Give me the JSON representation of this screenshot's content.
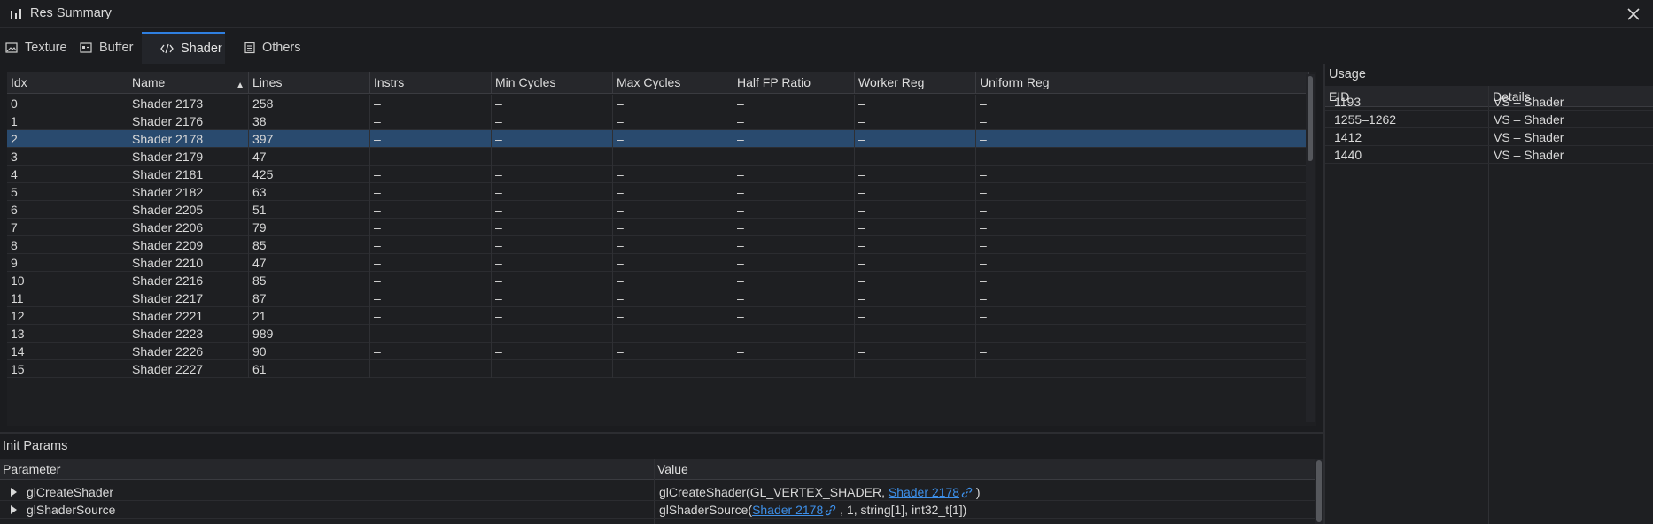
{
  "window": {
    "title": "Res Summary"
  },
  "tabs": [
    {
      "label": "Texture",
      "icon": "image-icon"
    },
    {
      "label": "Buffer",
      "icon": "buffer-icon"
    },
    {
      "label": "Shader",
      "icon": "code-icon",
      "active": true
    },
    {
      "label": "Others",
      "icon": "list-icon"
    }
  ],
  "shader_table": {
    "columns": [
      "Idx",
      "Name",
      "Lines",
      "Instrs",
      "Min Cycles",
      "Max Cycles",
      "Half FP Ratio",
      "Worker Reg",
      "Uniform Reg"
    ],
    "sorted_column": "Name",
    "selected_row": 2,
    "rows": [
      [
        "0",
        "Shader 2173",
        "258",
        "–",
        "–",
        "–",
        "–",
        "–",
        "–"
      ],
      [
        "1",
        "Shader 2176",
        "38",
        "–",
        "–",
        "–",
        "–",
        "–",
        "–"
      ],
      [
        "2",
        "Shader 2178",
        "397",
        "–",
        "–",
        "–",
        "–",
        "–",
        "–"
      ],
      [
        "3",
        "Shader 2179",
        "47",
        "–",
        "–",
        "–",
        "–",
        "–",
        "–"
      ],
      [
        "4",
        "Shader 2181",
        "425",
        "–",
        "–",
        "–",
        "–",
        "–",
        "–"
      ],
      [
        "5",
        "Shader 2182",
        "63",
        "–",
        "–",
        "–",
        "–",
        "–",
        "–"
      ],
      [
        "6",
        "Shader 2205",
        "51",
        "–",
        "–",
        "–",
        "–",
        "–",
        "–"
      ],
      [
        "7",
        "Shader 2206",
        "79",
        "–",
        "–",
        "–",
        "–",
        "–",
        "–"
      ],
      [
        "8",
        "Shader 2209",
        "85",
        "–",
        "–",
        "–",
        "–",
        "–",
        "–"
      ],
      [
        "9",
        "Shader 2210",
        "47",
        "–",
        "–",
        "–",
        "–",
        "–",
        "–"
      ],
      [
        "10",
        "Shader 2216",
        "85",
        "–",
        "–",
        "–",
        "–",
        "–",
        "–"
      ],
      [
        "11",
        "Shader 2217",
        "87",
        "–",
        "–",
        "–",
        "–",
        "–",
        "–"
      ],
      [
        "12",
        "Shader 2221",
        "21",
        "–",
        "–",
        "–",
        "–",
        "–",
        "–"
      ],
      [
        "13",
        "Shader 2223",
        "989",
        "–",
        "–",
        "–",
        "–",
        "–",
        "–"
      ],
      [
        "14",
        "Shader 2226",
        "90",
        "–",
        "–",
        "–",
        "–",
        "–",
        "–"
      ],
      [
        "15",
        "Shader 2227",
        "61",
        "",
        "",
        "",
        "",
        "",
        ""
      ]
    ]
  },
  "usage": {
    "title": "Usage",
    "columns": [
      "EID",
      "Details"
    ],
    "rows": [
      [
        "1193",
        "VS – Shader"
      ],
      [
        "1255–1262",
        "VS – Shader"
      ],
      [
        "1412",
        "VS – Shader"
      ],
      [
        "1440",
        "VS – Shader"
      ]
    ]
  },
  "init_params": {
    "title": "Init Params",
    "columns": [
      "Parameter",
      "Value"
    ],
    "rows": [
      {
        "param": "glCreateShader",
        "value_prefix": "glCreateShader(GL_VERTEX_SHADER, ",
        "link": "Shader 2178",
        "value_suffix": " )"
      },
      {
        "param": "glShaderSource",
        "value_prefix": "glShaderSource(",
        "link": "Shader 2178",
        "value_suffix": " , 1, string[1], int32_t[1])"
      }
    ]
  },
  "colors": {
    "accent": "#2f7fe0",
    "selection": "#294a6e",
    "link": "#3d8fe8",
    "background": "#1b1c1f"
  }
}
